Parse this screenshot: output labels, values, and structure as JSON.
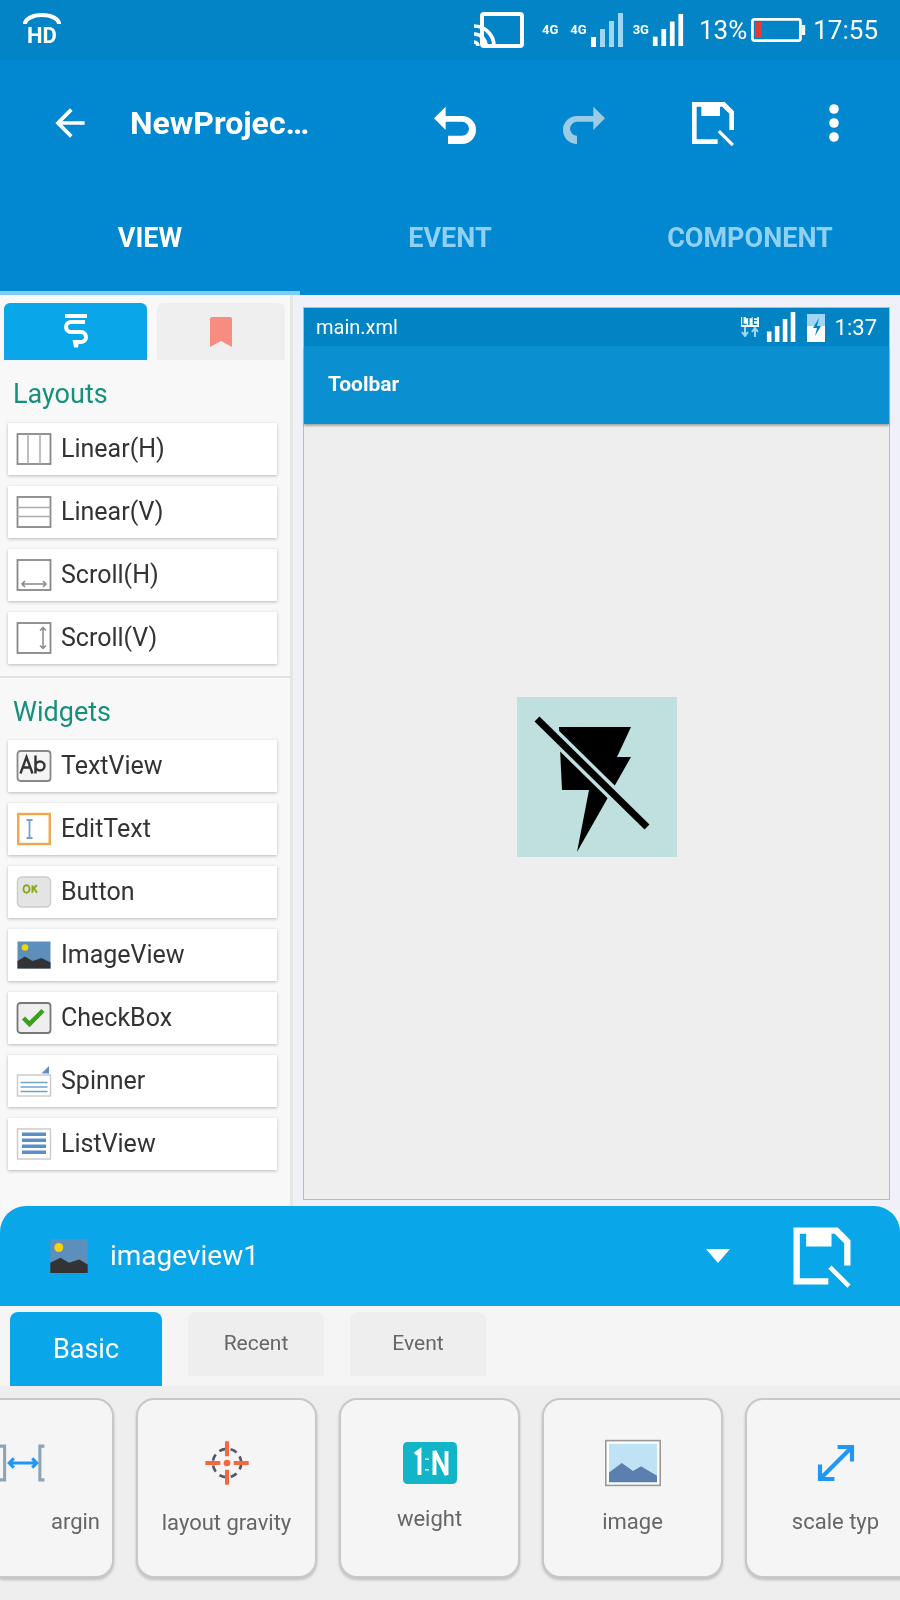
{
  "status_bar": {
    "hd_label": "HD",
    "network_labels": [
      "4G",
      "4G",
      "3G"
    ],
    "battery": "13%",
    "time": "17:55"
  },
  "app_bar": {
    "title": "NewProjec…",
    "actions": [
      {
        "kind": "back",
        "disabled": false
      },
      {
        "kind": "undo",
        "disabled": false
      },
      {
        "kind": "redo",
        "disabled": true
      },
      {
        "kind": "save",
        "disabled": false
      },
      {
        "kind": "more",
        "disabled": false
      }
    ]
  },
  "tabs": [
    {
      "label": "VIEW",
      "selected": true
    },
    {
      "label": "EVENT",
      "selected": false
    },
    {
      "label": "COMPONENT",
      "selected": false
    }
  ],
  "palette": {
    "tabs": [
      {
        "kind": "widgets",
        "selected": true
      },
      {
        "kind": "bookmarks",
        "selected": false
      }
    ],
    "sections": [
      {
        "title": "Layouts",
        "items": [
          {
            "label": "Linear(H)",
            "kind": "linear_h"
          },
          {
            "label": "Linear(V)",
            "kind": "linear_v"
          },
          {
            "label": "Scroll(H)",
            "kind": "scroll_h"
          },
          {
            "label": "Scroll(V)",
            "kind": "scroll_v"
          }
        ]
      },
      {
        "title": "Widgets",
        "items": [
          {
            "label": "TextView",
            "kind": "textview"
          },
          {
            "label": "EditText",
            "kind": "edittext"
          },
          {
            "label": "Button",
            "kind": "button"
          },
          {
            "label": "ImageView",
            "kind": "imageview"
          },
          {
            "label": "CheckBox",
            "kind": "checkbox"
          },
          {
            "label": "Spinner",
            "kind": "spinner"
          },
          {
            "label": "ListView",
            "kind": "listview"
          }
        ]
      }
    ]
  },
  "preview": {
    "file_name": "main.xml",
    "network_label": "LTE",
    "time": "1:37",
    "toolbar_title": "Toolbar"
  },
  "property_sheet": {
    "widget_id": "imageview1",
    "tabs": [
      {
        "label": "Basic",
        "selected": true
      },
      {
        "label": "Recent",
        "selected": false
      },
      {
        "label": "Event",
        "selected": false
      }
    ],
    "properties": [
      {
        "label": "argin",
        "kind": "margin"
      },
      {
        "label": "layout gravity",
        "kind": "gravity"
      },
      {
        "label": "weight",
        "kind": "weight"
      },
      {
        "label": "image",
        "kind": "image"
      },
      {
        "label": "scale typ",
        "kind": "scale"
      }
    ]
  }
}
